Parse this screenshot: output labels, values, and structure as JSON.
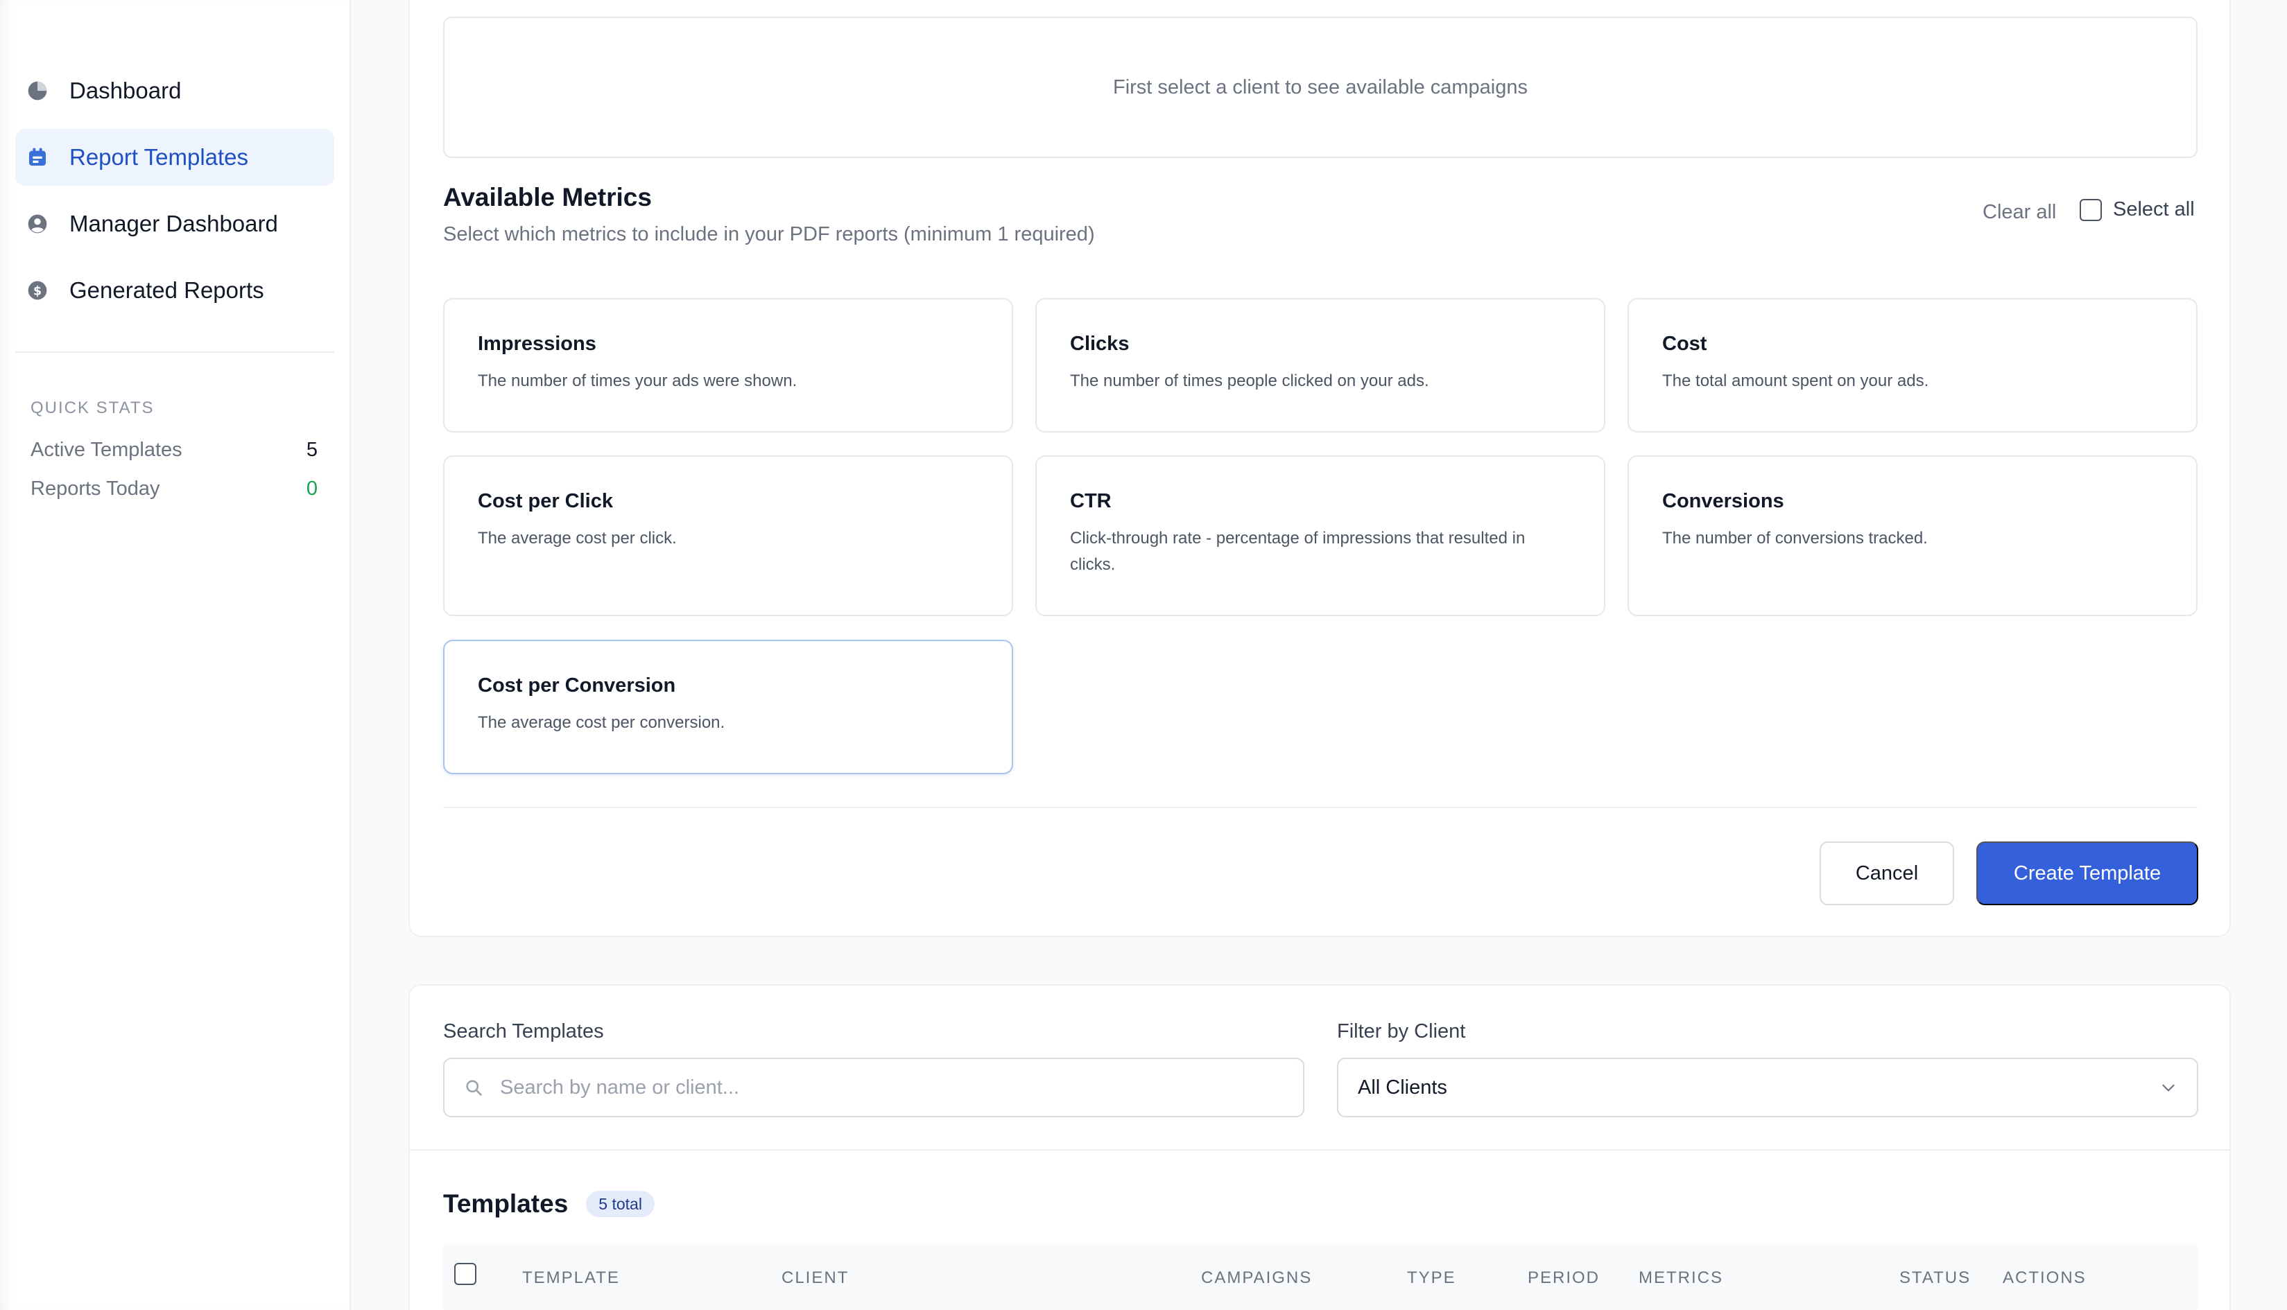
{
  "sidebar": {
    "nav": [
      {
        "label": "Dashboard",
        "icon": "pie-chart-icon"
      },
      {
        "label": "Report Templates",
        "icon": "template-icon",
        "active": true
      },
      {
        "label": "Manager Dashboard",
        "icon": "user-circle-icon"
      },
      {
        "label": "Generated Reports",
        "icon": "dollar-icon"
      }
    ],
    "quick_stats": {
      "title": "QUICK STATS",
      "items": [
        {
          "label": "Active Templates",
          "value": "5"
        },
        {
          "label": "Reports Today",
          "value": "0"
        }
      ]
    }
  },
  "form": {
    "campaigns_placeholder": "First select a client to see available campaigns",
    "metrics_title": "Available Metrics",
    "metrics_subtitle": "Select which metrics to include in your PDF reports (minimum 1 required)",
    "clear_all": "Clear all",
    "select_all": "Select all",
    "metrics": [
      {
        "name": "Impressions",
        "desc": "The number of times your ads were shown."
      },
      {
        "name": "Clicks",
        "desc": "The number of times people clicked on your ads."
      },
      {
        "name": "Cost",
        "desc": "The total amount spent on your ads."
      },
      {
        "name": "Cost per Click",
        "desc": "The average cost per click."
      },
      {
        "name": "CTR",
        "desc": "Click-through rate - percentage of impressions that resulted in clicks."
      },
      {
        "name": "Conversions",
        "desc": "The number of conversions tracked."
      },
      {
        "name": "Cost per Conversion",
        "desc": "The average cost per conversion."
      }
    ],
    "cancel_label": "Cancel",
    "create_label": "Create Template"
  },
  "filters": {
    "search_label": "Search Templates",
    "search_placeholder": "Search by name or client...",
    "client_label": "Filter by Client",
    "client_value": "All Clients"
  },
  "templates": {
    "title": "Templates",
    "count_badge": "5 total",
    "columns": [
      "TEMPLATE",
      "CLIENT",
      "CAMPAIGNS",
      "TYPE",
      "PERIOD",
      "METRICS",
      "STATUS",
      "ACTIONS"
    ]
  },
  "colors": {
    "accent": "#3461db",
    "active_nav_bg": "#eef4fd",
    "success": "#16a34a"
  }
}
